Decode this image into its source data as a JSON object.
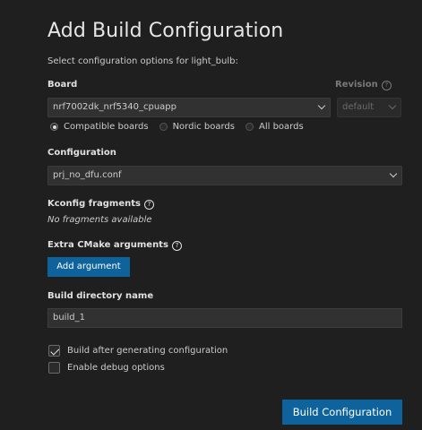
{
  "dialog": {
    "title": "Add Build Configuration",
    "subtitle": "Select configuration options for light_bulb:"
  },
  "board": {
    "label": "Board",
    "value": "nrf7002dk_nrf5340_cpuapp",
    "filters": [
      {
        "label": "Compatible boards",
        "selected": true
      },
      {
        "label": "Nordic boards",
        "selected": false
      },
      {
        "label": "All boards",
        "selected": false
      }
    ]
  },
  "revision": {
    "label": "Revision",
    "value": "default",
    "disabled": true
  },
  "configuration": {
    "label": "Configuration",
    "value": "prj_no_dfu.conf"
  },
  "kconfig": {
    "label": "Kconfig fragments",
    "empty_text": "No fragments available"
  },
  "cmake": {
    "label": "Extra CMake arguments",
    "add_label": "Add argument"
  },
  "build_dir": {
    "label": "Build directory name",
    "value": "build_1"
  },
  "options": {
    "build_after": {
      "label": "Build after generating configuration",
      "checked": true
    },
    "debug": {
      "label": "Enable debug options",
      "checked": false
    }
  },
  "actions": {
    "submit_label": "Build Configuration"
  },
  "icons": {
    "help": "help-circle-icon",
    "chevron": "chevron-down-icon",
    "check": "check-icon"
  },
  "colors": {
    "background": "#1f1f1f",
    "accent": "#0e639c",
    "input": "#313131"
  }
}
